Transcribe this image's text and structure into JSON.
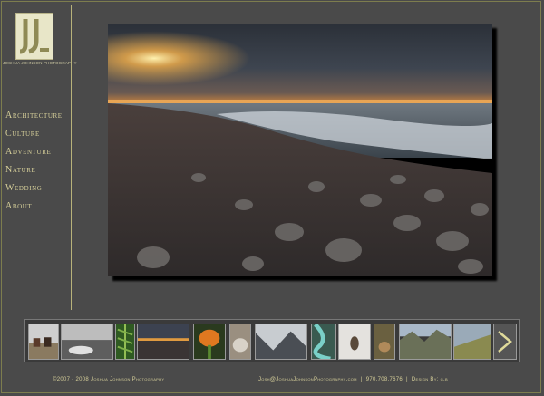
{
  "logo": {
    "caption": "Joshua Johnson Photography",
    "icon": "jj-monogram-icon"
  },
  "nav": {
    "items": [
      {
        "label": "Architecture"
      },
      {
        "label": "Culture"
      },
      {
        "label": "Adventure"
      },
      {
        "label": "Nature"
      },
      {
        "label": "Wedding"
      },
      {
        "label": "About"
      }
    ]
  },
  "main_photo": {
    "subject": "sunset over rocky beach and ocean waves"
  },
  "thumbnails": {
    "items": [
      {
        "subject": "horses"
      },
      {
        "subject": "black and white landscape"
      },
      {
        "subject": "fern"
      },
      {
        "subject": "sunset beach"
      },
      {
        "subject": "orange flower"
      },
      {
        "subject": "pebbles"
      },
      {
        "subject": "misty mountain valley"
      },
      {
        "subject": "river from above"
      },
      {
        "subject": "bird in snow"
      },
      {
        "subject": "small animal"
      },
      {
        "subject": "mountain range"
      },
      {
        "subject": "mountain slope"
      }
    ],
    "next_icon": "chevron-right-icon"
  },
  "footer": {
    "copyright": "©2007 - 2008 Joshua Johnson Photography",
    "email": "Josh@JoshuaJohnsonPhotography.com",
    "phone": "970.708.7676",
    "design": "Design By: g.b"
  },
  "colors": {
    "background": "#4a4a4a",
    "accent": "#d7d09a"
  }
}
